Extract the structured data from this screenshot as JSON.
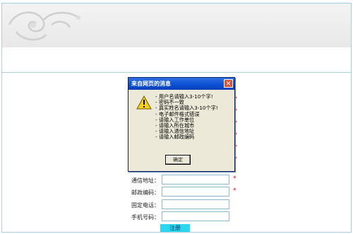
{
  "dialog": {
    "title": "来自网页的消息",
    "close_glyph": "✕",
    "messages": [
      "- 用户名请输入3-10个字!",
      "- 密码不一致",
      "- 真实姓名请输入3-10个字!",
      "- 电子邮件格式错误",
      "- 请输入工作单位",
      "- 请输入所在城市",
      "- 请输入通信地址",
      "- 请输入邮政编码"
    ],
    "ok_label": "确定",
    "icon": "warning-icon"
  },
  "form": {
    "fields": [
      {
        "label": "通信地址：",
        "value": "",
        "required": true
      },
      {
        "label": "邮政编码：",
        "value": "",
        "required": true
      },
      {
        "label": "固定电话：",
        "value": "",
        "required": false
      },
      {
        "label": "手机号码：",
        "value": "",
        "required": false
      }
    ],
    "required_mark": "*",
    "submit_label": "注册"
  },
  "colors": {
    "border": "#a9cde0",
    "submit_bg": "#2ad7f0",
    "titlebar": "#0a4fd4",
    "required": "#e00000"
  }
}
